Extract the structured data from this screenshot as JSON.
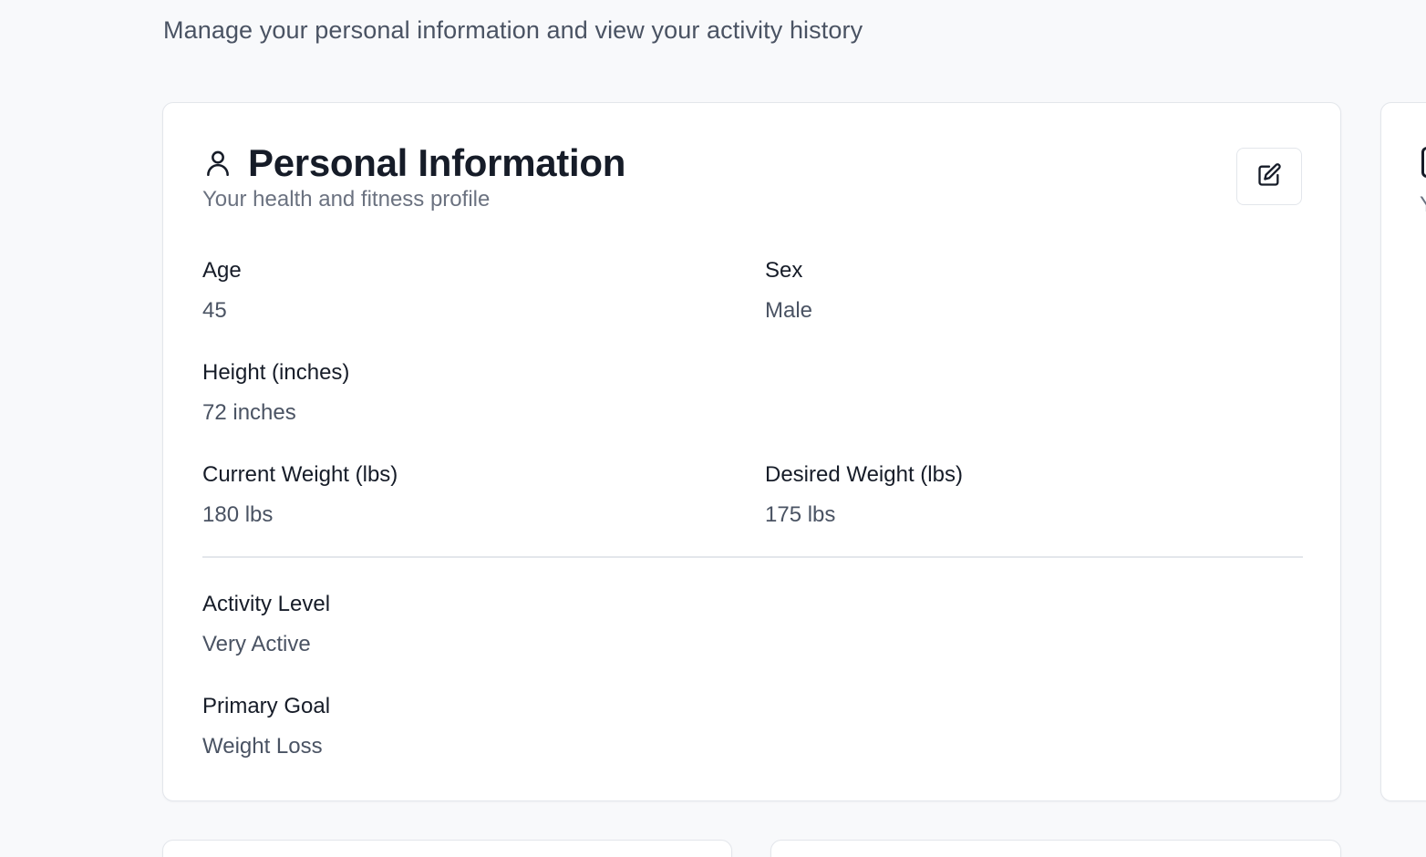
{
  "page": {
    "subtitle": "Manage your personal information and view your activity history"
  },
  "personal_info": {
    "title": "Personal Information",
    "description": "Your health and fitness profile",
    "title_icon": "user-icon",
    "edit_icon": "edit-icon",
    "fields": {
      "age": {
        "label": "Age",
        "value": "45"
      },
      "sex": {
        "label": "Sex",
        "value": "Male"
      },
      "height": {
        "label": "Height (inches)",
        "value": "72 inches"
      },
      "current_weight": {
        "label": "Current Weight (lbs)",
        "value": "180 lbs"
      },
      "desired_weight": {
        "label": "Desired Weight (lbs)",
        "value": "175 lbs"
      },
      "activity_level": {
        "label": "Activity Level",
        "value": "Very Active"
      },
      "primary_goal": {
        "label": "Primary Goal",
        "value": "Weight Loss"
      }
    }
  },
  "right_card": {
    "partial_text": "Y"
  }
}
